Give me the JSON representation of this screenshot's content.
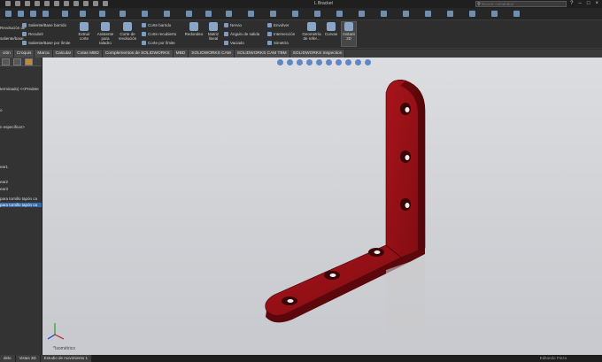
{
  "window": {
    "title": "L Bracket",
    "search_placeholder": "Buscar comandos"
  },
  "ribbon": {
    "groups": [
      {
        "label1": "Saliente/Base barrido",
        "label2": "Recubrir",
        "label3": "Saliente/Base por límite"
      },
      {
        "big1": "Extruir corte",
        "big2": "Asistente para taladro",
        "big3": "Corte de revolución"
      },
      {
        "label1": "Corte barrido",
        "label2": "Corte recubierto",
        "label3": "Corte por límite"
      },
      {
        "big1": "Redondeo",
        "big2": "Matriz lineal"
      },
      {
        "label1": "Nervio",
        "label2": "Ángulo de salida",
        "label3": "Vaciado"
      },
      {
        "label1": "Envolver",
        "label2": "Intersección",
        "label3": "Simetría"
      },
      {
        "big1": "Geometría de refer...",
        "big2": "Curvas",
        "big3": "Instant 3D"
      }
    ],
    "left_cut": [
      "Revolución de",
      "saliente/base"
    ]
  },
  "tabs": [
    "ción",
    "Croquis",
    "Marca",
    "Calcular",
    "Cotas MBD",
    "Complementos de SOLIDWORKS",
    "MBD",
    "SOLIDWORKS CAM",
    "SOLIDWORKS CAM TBM",
    "SOLIDWORKS Inspection"
  ],
  "tree": {
    "items": [
      {
        "text": "terminado) <<Predete",
        "sel": false
      },
      {
        "text": "o",
        "sel": false
      },
      {
        "text": "n especificar>",
        "sel": false
      },
      {
        "text": "ear1",
        "sel": false
      },
      {
        "text": "ear2",
        "sel": false
      },
      {
        "text": "ear3",
        "sel": false
      },
      {
        "text": "para tornillo tapón ca",
        "sel": false
      },
      {
        "text": "para tornillo tapón ca",
        "sel": true
      }
    ]
  },
  "viewport": {
    "view_label": "*Isométrico",
    "part_color": "#8b0f14"
  },
  "statusbar": {
    "tabs": [
      "delo",
      "Vistas 3D",
      "Estudio de movimiento 1"
    ],
    "right_text": "Editando Pieza"
  }
}
